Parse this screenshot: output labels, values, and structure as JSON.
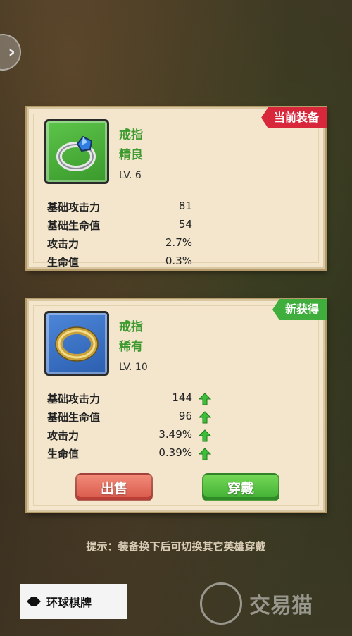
{
  "current": {
    "tag": "当前装备",
    "name": "戒指",
    "rarity": "精良",
    "level": "LV. 6",
    "stats": [
      {
        "label": "基础攻击力",
        "value": "81"
      },
      {
        "label": "基础生命值",
        "value": "54"
      },
      {
        "label": "攻击力",
        "value": "2.7%"
      },
      {
        "label": "生命值",
        "value": "0.3%"
      }
    ]
  },
  "new_item": {
    "tag": "新获得",
    "name": "戒指",
    "rarity": "稀有",
    "level": "LV. 10",
    "stats": [
      {
        "label": "基础攻击力",
        "value": "144"
      },
      {
        "label": "基础生命值",
        "value": "96"
      },
      {
        "label": "攻击力",
        "value": "3.49%"
      },
      {
        "label": "生命值",
        "value": "0.39%"
      }
    ],
    "sell_label": "出售",
    "equip_label": "穿戴"
  },
  "hint": "提示：装备换下后可切换其它英雄穿戴",
  "watermark_left": "环球棋牌",
  "watermark_right": "交易猫",
  "colors": {
    "rarity_green": "#3d9a2f",
    "tag_red": "#d8263a",
    "tag_green": "#3fae3c",
    "sell_button": "#e06a5a",
    "equip_button": "#52c040"
  },
  "icons": {
    "current_item": "silver-ring-blue-gem-icon",
    "new_item": "gold-band-ring-icon",
    "stat_increase": "green-up-arrow-icon",
    "back": "chevron-right-icon"
  }
}
